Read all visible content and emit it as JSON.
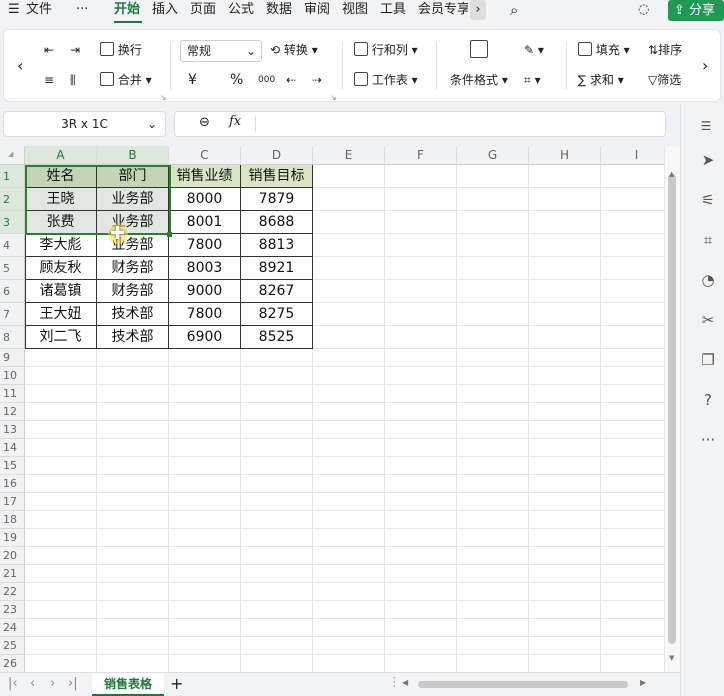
{
  "menubar": {
    "menu_icon": "hamburger-icon",
    "file_label": "文件",
    "more_label": "···",
    "tabs": [
      "开始",
      "插入",
      "页面",
      "公式",
      "数据",
      "审阅",
      "视图",
      "工具",
      "会员专享"
    ],
    "active_tab": "开始",
    "share_label": "分享"
  },
  "ribbon": {
    "wrap_label": "换行",
    "merge_label": "合并",
    "number_format": "常规",
    "convert_label": "转换",
    "currency_symbol": "¥",
    "percent_symbol": "%",
    "thousands_symbol": "000",
    "rows_cols_label": "行和列",
    "worksheet_label": "工作表",
    "conditional_format_label": "条件格式",
    "fill_label": "填充",
    "sum_label": "求和",
    "sort_label": "排序",
    "filter_label": "筛选"
  },
  "formula_bar": {
    "name_box": "3R x 1C",
    "fx_label": "fx",
    "formula_value": ""
  },
  "sheet": {
    "columns": [
      "A",
      "B",
      "C",
      "D",
      "E",
      "F",
      "G",
      "H",
      "I"
    ],
    "row_numbers": [
      "1",
      "2",
      "3",
      "4",
      "5",
      "6",
      "7",
      "8",
      "9",
      "10",
      "11",
      "12",
      "13",
      "14",
      "15",
      "16",
      "17",
      "18",
      "19",
      "20",
      "21",
      "22",
      "23",
      "24",
      "25",
      "26"
    ],
    "table": [
      [
        "姓名",
        "部门",
        "销售业绩",
        "销售目标"
      ],
      [
        "王晓",
        "业务部",
        "8000",
        "7879"
      ],
      [
        "张费",
        "业务部",
        "8001",
        "8688"
      ],
      [
        "李大彪",
        "业务部",
        "7800",
        "8813"
      ],
      [
        "顾友秋",
        "财务部",
        "8003",
        "8921"
      ],
      [
        "诸葛镇",
        "财务部",
        "9000",
        "8267"
      ],
      [
        "王大妞",
        "技术部",
        "7800",
        "8275"
      ],
      [
        "刘二飞",
        "技术部",
        "6900",
        "8525"
      ]
    ],
    "selected_columns": [
      "A",
      "B"
    ],
    "selected_rows": [
      "1",
      "2",
      "3"
    ]
  },
  "tabbar": {
    "sheet_tab": "销售表格",
    "add_sheet": "+"
  },
  "colors": {
    "accent": "#1e7a3c",
    "header_fill": "#d7e7c6",
    "share_button": "#1e9a55"
  }
}
